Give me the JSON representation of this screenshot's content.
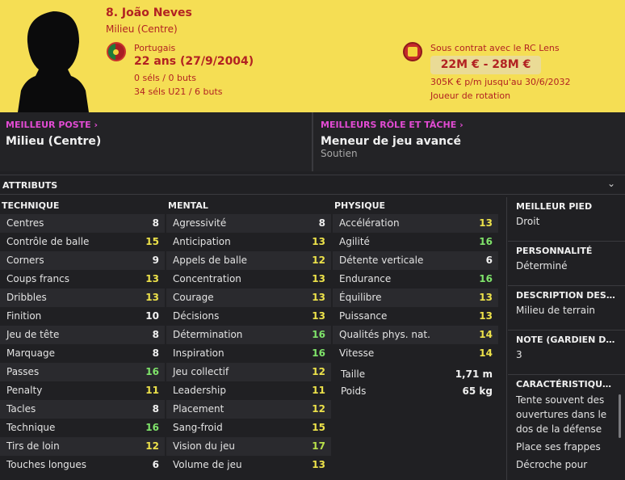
{
  "header": {
    "player_name": "8. João Neves",
    "position": "Milieu (Centre)",
    "nationality": "Portugais",
    "age": "22 ans (27/9/2004)",
    "caps": "0 séls / 0 buts",
    "caps_u21": "34 séls U21 / 6 buts",
    "contract": "Sous contrat avec le RC Lens",
    "value": "22M € - 28M €",
    "wage": "305K € p/m jusqu'au 30/6/2032",
    "squad_status": "Joueur de rotation"
  },
  "best_position": {
    "label": "MEILLEUR POSTE",
    "value": "Milieu (Centre)"
  },
  "best_role": {
    "label": "MEILLEURS RÔLE ET TÂCHE",
    "value": "Meneur de jeu avancé",
    "duty": "Soutien"
  },
  "attributes_title": "ATTRIBUTS",
  "technique": {
    "title": "TECHNIQUE",
    "rows": [
      {
        "name": "Centres",
        "value": "8"
      },
      {
        "name": "Contrôle de balle",
        "value": "15"
      },
      {
        "name": "Corners",
        "value": "9"
      },
      {
        "name": "Coups francs",
        "value": "13"
      },
      {
        "name": "Dribbles",
        "value": "13"
      },
      {
        "name": "Finition",
        "value": "10"
      },
      {
        "name": "Jeu de tête",
        "value": "8"
      },
      {
        "name": "Marquage",
        "value": "8"
      },
      {
        "name": "Passes",
        "value": "16"
      },
      {
        "name": "Penalty",
        "value": "11"
      },
      {
        "name": "Tacles",
        "value": "8"
      },
      {
        "name": "Technique",
        "value": "16"
      },
      {
        "name": "Tirs de loin",
        "value": "12"
      },
      {
        "name": "Touches longues",
        "value": "6"
      }
    ]
  },
  "mental": {
    "title": "MENTAL",
    "rows": [
      {
        "name": "Agressivité",
        "value": "8"
      },
      {
        "name": "Anticipation",
        "value": "13"
      },
      {
        "name": "Appels de balle",
        "value": "12"
      },
      {
        "name": "Concentration",
        "value": "13"
      },
      {
        "name": "Courage",
        "value": "13"
      },
      {
        "name": "Décisions",
        "value": "13"
      },
      {
        "name": "Détermination",
        "value": "16"
      },
      {
        "name": "Inspiration",
        "value": "16"
      },
      {
        "name": "Jeu collectif",
        "value": "12"
      },
      {
        "name": "Leadership",
        "value": "11"
      },
      {
        "name": "Placement",
        "value": "12"
      },
      {
        "name": "Sang-froid",
        "value": "15"
      },
      {
        "name": "Vision du jeu",
        "value": "17"
      },
      {
        "name": "Volume de jeu",
        "value": "13"
      }
    ]
  },
  "physique": {
    "title": "PHYSIQUE",
    "rows": [
      {
        "name": "Accélération",
        "value": "13"
      },
      {
        "name": "Agilité",
        "value": "16"
      },
      {
        "name": "Détente verticale",
        "value": "6"
      },
      {
        "name": "Endurance",
        "value": "16"
      },
      {
        "name": "Équilibre",
        "value": "13"
      },
      {
        "name": "Puissance",
        "value": "13"
      },
      {
        "name": "Qualités phys. nat.",
        "value": "14"
      },
      {
        "name": "Vitesse",
        "value": "14"
      }
    ],
    "height_label": "Taille",
    "height_value": "1,71 m",
    "weight_label": "Poids",
    "weight_value": "65 kg"
  },
  "side": {
    "foot_label": "MEILLEUR PIED",
    "foot_value": "Droit",
    "personality_label": "PERSONNALITÉ",
    "personality_value": "Déterminé",
    "description_label": "DESCRIPTION DES...",
    "description_value": "Milieu de terrain",
    "gk_label": "NOTE (GARDIEN DE...",
    "gk_value": "3",
    "traits_label": "CARACTÉRISTIQUE...",
    "traits": [
      "Tente souvent des ouvertures dans le dos de la défense",
      "Place ses frappes",
      "Décroche pour"
    ]
  },
  "colors": {
    "header_bg": "#f5de54",
    "header_text": "#b22222",
    "link_magenta": "#e24bd3",
    "rating_low": "#f0f0f0",
    "rating_mid": "#ece14a",
    "rating_high": "#7fe36a"
  }
}
